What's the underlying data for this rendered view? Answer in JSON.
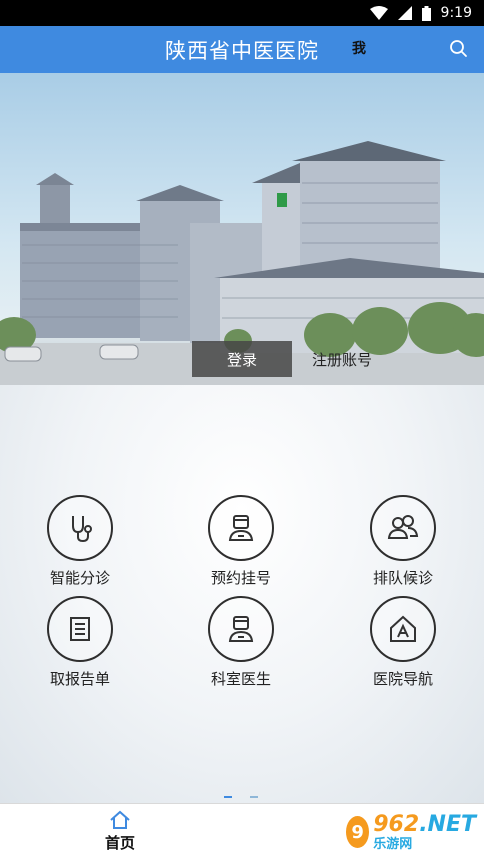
{
  "status_bar": {
    "time": "9:19"
  },
  "app_bar": {
    "title": "陕西省中医医院"
  },
  "banner": {
    "login_label": "登录",
    "register_label": "注册账号"
  },
  "menu": [
    {
      "label": "智能分诊",
      "icon": "stethoscope-icon"
    },
    {
      "label": "预约挂号",
      "icon": "doctor-icon"
    },
    {
      "label": "排队候诊",
      "icon": "people-icon"
    },
    {
      "label": "取报告单",
      "icon": "report-icon"
    },
    {
      "label": "科室医生",
      "icon": "doctor-icon"
    },
    {
      "label": "医院导航",
      "icon": "home-nav-icon"
    }
  ],
  "bottom_nav": {
    "home_label": "首页",
    "me_label": "我"
  },
  "watermark": {
    "circle": "9",
    "num_a": "962",
    "num_b": ".NET",
    "sub": "乐游网"
  },
  "colors": {
    "primary": "#3f8ae0",
    "watermark_orange": "#f59a1e",
    "watermark_blue": "#27a9e1"
  }
}
